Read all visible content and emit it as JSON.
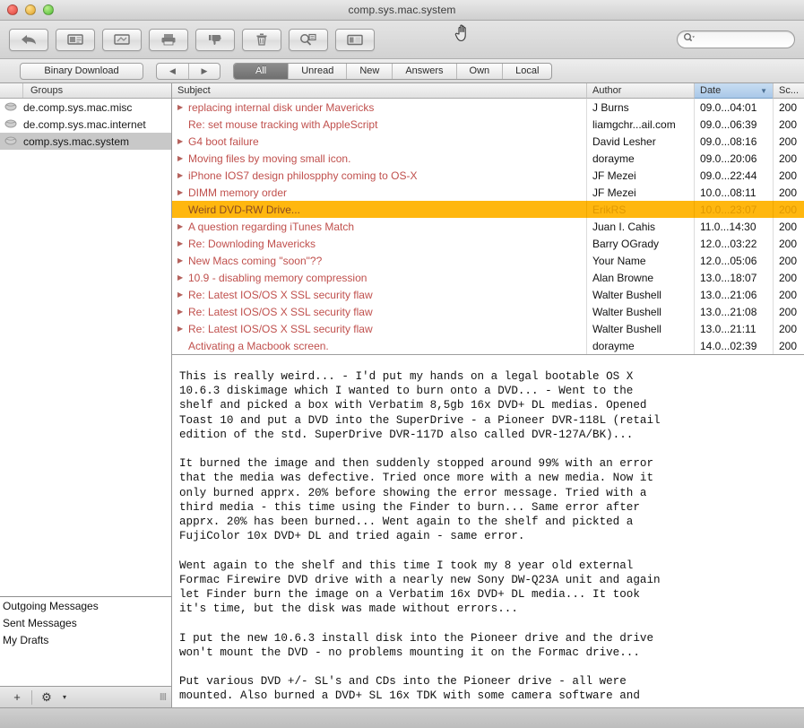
{
  "window": {
    "title": "comp.sys.mac.system",
    "traffic_lights": [
      "close",
      "minimize",
      "zoom"
    ]
  },
  "toolbar": {
    "buttons": [
      {
        "name": "reply-button",
        "icon": "reply-arrow-icon"
      },
      {
        "name": "new-message-button",
        "icon": "message-card-icon"
      },
      {
        "name": "forward-button",
        "icon": "image-arrow-icon"
      },
      {
        "name": "print-button",
        "icon": "printer-icon"
      },
      {
        "name": "mark-unwanted-button",
        "icon": "thumbs-down-icon"
      },
      {
        "name": "delete-button",
        "icon": "trash-icon"
      },
      {
        "name": "find-message-button",
        "icon": "card-search-icon"
      },
      {
        "name": "toggle-layout-button",
        "icon": "split-view-icon"
      }
    ],
    "search": {
      "value": "",
      "placeholder": "",
      "icon": "search-magnifier-icon"
    }
  },
  "filterbar": {
    "binary_download": "Binary Download",
    "nav_prev": "◀",
    "nav_next": "▶",
    "segments": [
      {
        "label": "All",
        "active": true
      },
      {
        "label": "Unread",
        "active": false
      },
      {
        "label": "New",
        "active": false
      },
      {
        "label": "Answers",
        "active": false
      },
      {
        "label": "Own",
        "active": false
      },
      {
        "label": "Local",
        "active": false
      }
    ]
  },
  "groups": {
    "header": "Groups",
    "items": [
      {
        "label": "de.comp.sys.mac.misc",
        "selected": false
      },
      {
        "label": "de.comp.sys.mac.internet",
        "selected": false
      },
      {
        "label": "comp.sys.mac.system",
        "selected": true
      }
    ]
  },
  "mailboxes": {
    "items": [
      {
        "label": "Outgoing Messages"
      },
      {
        "label": "Sent Messages"
      },
      {
        "label": "My Drafts"
      }
    ]
  },
  "left_footer": {
    "add_label": "+",
    "gear_label": "⚙",
    "gear_caret": "▾",
    "grip": "‖‖"
  },
  "message_list": {
    "columns": [
      {
        "key": "subject",
        "label": "Subject",
        "sorted": false
      },
      {
        "key": "author",
        "label": "Author",
        "sorted": false
      },
      {
        "key": "date",
        "label": "Date",
        "sorted": true,
        "caret": "▼"
      },
      {
        "key": "score",
        "label": "Sc...",
        "sorted": false
      }
    ],
    "rows": [
      {
        "subject": "replacing internal disk under Mavericks",
        "author": "J Burns",
        "date": "09.0...04:01",
        "score": "200",
        "expandable": true,
        "selected": false
      },
      {
        "subject": "Re: set mouse tracking with AppleScript",
        "author": "liamgchr...ail.com",
        "date": "09.0...06:39",
        "score": "200",
        "expandable": false,
        "selected": false
      },
      {
        "subject": "G4 boot failure",
        "author": "David Lesher",
        "date": "09.0...08:16",
        "score": "200",
        "expandable": true,
        "selected": false
      },
      {
        "subject": "Moving files by moving small icon.",
        "author": "dorayme",
        "date": "09.0...20:06",
        "score": "200",
        "expandable": true,
        "selected": false
      },
      {
        "subject": "iPhone IOS7 design philospphy coming to OS-X",
        "author": "JF Mezei",
        "date": "09.0...22:44",
        "score": "200",
        "expandable": true,
        "selected": false
      },
      {
        "subject": "DIMM memory order",
        "author": "JF Mezei",
        "date": "10.0...08:11",
        "score": "200",
        "expandable": true,
        "selected": false
      },
      {
        "subject": "Weird DVD-RW Drive...",
        "author": "ErikRS",
        "date": "10.0...23:07",
        "score": "200",
        "expandable": false,
        "selected": true
      },
      {
        "subject": "A question regarding iTunes Match",
        "author": "Juan I. Cahis",
        "date": "11.0...14:30",
        "score": "200",
        "expandable": true,
        "selected": false
      },
      {
        "subject": "Re: Downloding Mavericks",
        "author": "Barry OGrady",
        "date": "12.0...03:22",
        "score": "200",
        "expandable": true,
        "selected": false
      },
      {
        "subject": "New Macs coming \"soon\"??",
        "author": "Your Name",
        "date": "12.0...05:06",
        "score": "200",
        "expandable": true,
        "selected": false
      },
      {
        "subject": "10.9 - disabling memory compression",
        "author": "Alan Browne",
        "date": "13.0...18:07",
        "score": "200",
        "expandable": true,
        "selected": false
      },
      {
        "subject": "Re: Latest IOS/OS X SSL security flaw",
        "author": "Walter Bushell",
        "date": "13.0...21:06",
        "score": "200",
        "expandable": true,
        "selected": false
      },
      {
        "subject": "Re: Latest IOS/OS X SSL security flaw",
        "author": "Walter Bushell",
        "date": "13.0...21:08",
        "score": "200",
        "expandable": true,
        "selected": false
      },
      {
        "subject": "Re: Latest IOS/OS X SSL security flaw",
        "author": "Walter Bushell",
        "date": "13.0...21:11",
        "score": "200",
        "expandable": true,
        "selected": false
      },
      {
        "subject": "Activating a Macbook screen.",
        "author": "dorayme",
        "date": "14.0...02:39",
        "score": "200",
        "expandable": false,
        "selected": false
      }
    ]
  },
  "message_body": {
    "text": "This is really weird... - I'd put my hands on a legal bootable OS X\n10.6.3 diskimage which I wanted to burn onto a DVD... - Went to the\nshelf and picked a box with Verbatim 8,5gb 16x DVD+ DL medias. Opened\nToast 10 and put a DVD into the SuperDrive - a Pioneer DVR-118L (retail\nedition of the std. SuperDrive DVR-117D also called DVR-127A/BK)...\n\nIt burned the image and then suddenly stopped around 99% with an error\nthat the media was defective. Tried once more with a new media. Now it\nonly burned apprx. 20% before showing the error message. Tried with a\nthird media - this time using the Finder to burn... Same error after\napprx. 20% has been burned... Went again to the shelf and pickted a\nFujiColor 10x DVD+ DL and tried again - same error.\n\nWent again to the shelf and this time I took my 8 year old external\nFormac Firewire DVD drive with a nearly new Sony DW-Q23A unit and again\nlet Finder burn the image on a Verbatim 16x DVD+ DL media... It took\nit's time, but the disk was made without errors...\n\nI put the new 10.6.3 install disk into the Pioneer drive and the drive\nwon't mount the DVD - no problems mounting it on the Formac drive...\n\nPut various DVD +/- SL's and CDs into the Pioneer drive - all were\nmounted. Also burned a DVD+ SL 16x TDK with some camera software and"
  },
  "colors": {
    "selection_orange": "#ffb70f",
    "subject_red": "#c0504d",
    "sorted_header_blue": "#a9c8e8",
    "group_selection_gray": "#c8c8c8"
  }
}
